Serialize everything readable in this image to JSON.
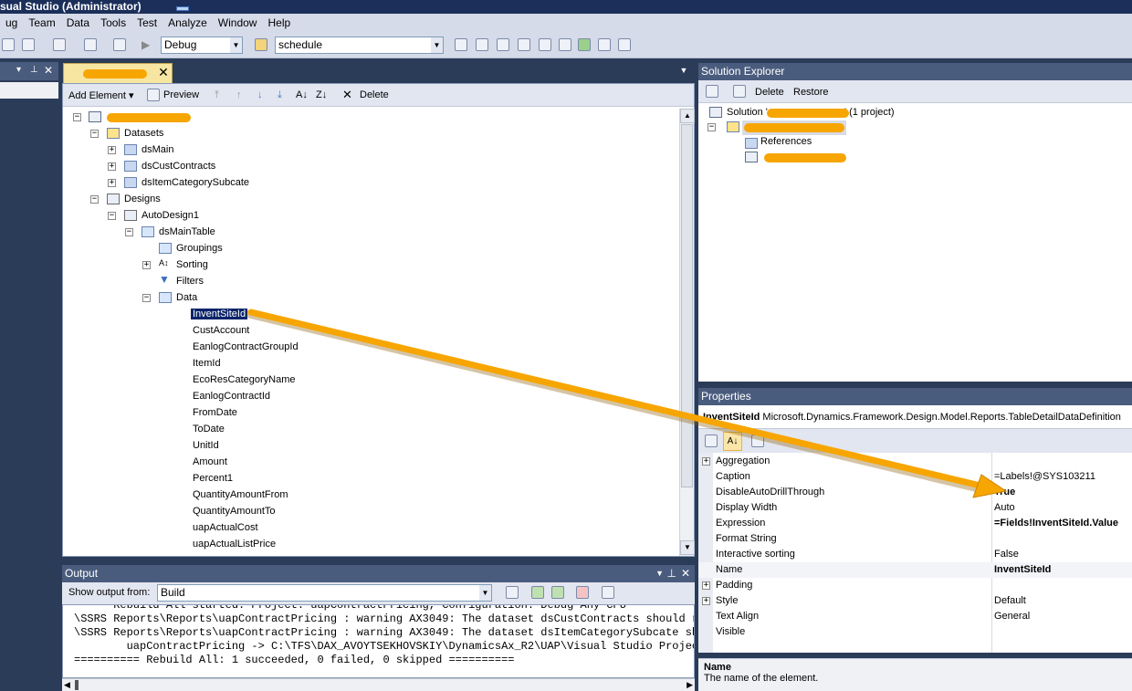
{
  "window": {
    "title": "sual Studio (Administrator)"
  },
  "menu": [
    "ug",
    "Team",
    "Data",
    "Tools",
    "Test",
    "Analyze",
    "Window",
    "Help"
  ],
  "toolbar": {
    "config_value": "Debug",
    "find_value": "schedule"
  },
  "designer": {
    "toolbar": {
      "add_element": "Add Element",
      "preview": "Preview",
      "delete": "Delete"
    },
    "tree": [
      {
        "label": "Datasets"
      },
      {
        "label": "dsMain"
      },
      {
        "label": "dsCustContracts"
      },
      {
        "label": "dsItemCategorySubcate"
      },
      {
        "label": "Designs"
      },
      {
        "label": "AutoDesign1"
      },
      {
        "label": "dsMainTable"
      },
      {
        "label": "Groupings"
      },
      {
        "label": "Sorting"
      },
      {
        "label": "Filters"
      },
      {
        "label": "Data"
      }
    ],
    "fields": [
      "InventSiteId",
      "CustAccount",
      "EanlogContractGroupId",
      "ItemId",
      "EcoResCategoryName",
      "EanlogContractId",
      "FromDate",
      "ToDate",
      "UnitId",
      "Amount",
      "Percent1",
      "QuantityAmountFrom",
      "QuantityAmountTo",
      "uapActualCost",
      "uapActualListPrice"
    ]
  },
  "output": {
    "title": "Output",
    "show_from_label": "Show output from:",
    "show_from_value": "Build",
    "lines": [
      "      Rebuild All started: Project: uapContractPricing, Configuration: Debug Any CPU",
      "\\SSRS Reports\\Reports\\uapContractPricing : warning AX3049: The dataset dsCustContracts should r",
      "\\SSRS Reports\\Reports\\uapContractPricing : warning AX3049: The dataset dsItemCategorySubcate sh",
      "        uapContractPricing -> C:\\TFS\\DAX_AVOYTSEKHOVSKIY\\DynamicsAx_R2\\UAP\\Visual Studio Projec",
      "========== Rebuild All: 1 succeeded, 0 failed, 0 skipped =========="
    ]
  },
  "solution_explorer": {
    "title": "Solution Explorer",
    "delete": "Delete",
    "restore": "Restore",
    "solution_prefix": "Solution '",
    "solution_suffix": "' (1 project)",
    "references": "References"
  },
  "properties": {
    "title": "Properties",
    "object_name": "InventSiteId",
    "object_type": "Microsoft.Dynamics.Framework.Design.Model.Reports.TableDetailDataDefinition",
    "rows": [
      {
        "name": "Aggregation",
        "value": "",
        "expandable": true,
        "bold": false
      },
      {
        "name": "Caption",
        "value": "=Labels!@SYS103211",
        "expandable": false,
        "bold": false
      },
      {
        "name": "DisableAutoDrillThrough",
        "value": "True",
        "expandable": false,
        "bold": true
      },
      {
        "name": "Display Width",
        "value": "Auto",
        "expandable": false,
        "bold": false
      },
      {
        "name": "Expression",
        "value": "=Fields!InventSiteId.Value",
        "expandable": false,
        "bold": true
      },
      {
        "name": "Format String",
        "value": "",
        "expandable": false,
        "bold": false
      },
      {
        "name": "Interactive sorting",
        "value": "False",
        "expandable": false,
        "bold": false
      },
      {
        "name": "Name",
        "value": "InventSiteId",
        "expandable": false,
        "bold": true
      },
      {
        "name": "Padding",
        "value": "",
        "expandable": true,
        "bold": false
      },
      {
        "name": "Style",
        "value": "Default",
        "expandable": true,
        "bold": false
      },
      {
        "name": "Text Align",
        "value": "General",
        "expandable": false,
        "bold": false
      },
      {
        "name": "Visible",
        "value": "",
        "expandable": false,
        "bold": false
      }
    ],
    "description_title": "Name",
    "description_text": "The name of the element."
  },
  "colors": {
    "annotation_arrow": "#f7a500",
    "selection": "#0a246a",
    "panel_header": "#4a5c7e"
  }
}
